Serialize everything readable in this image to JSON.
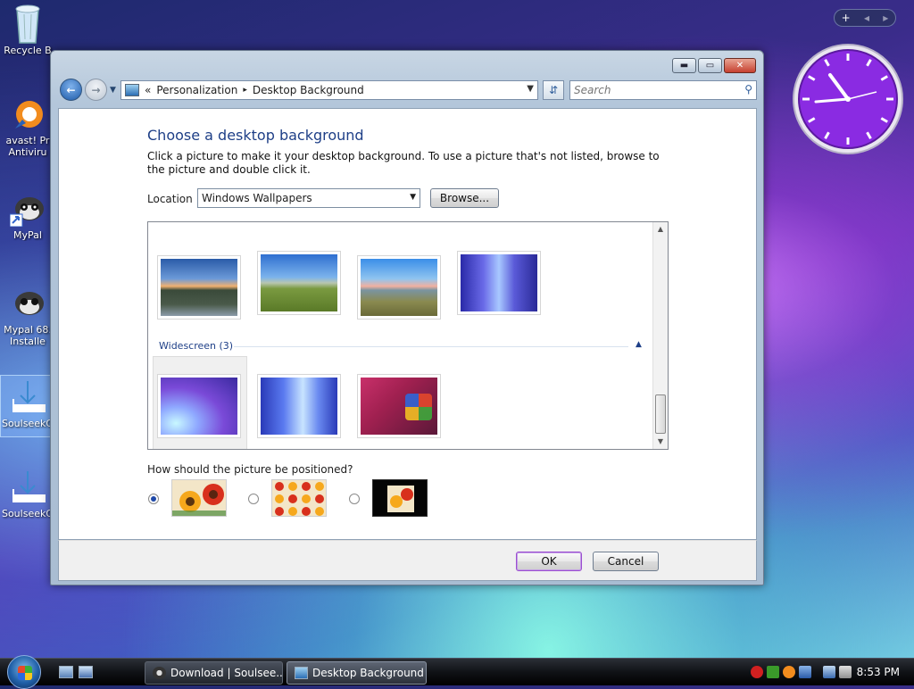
{
  "desktop": {
    "icons": [
      {
        "label": "Recycle B"
      },
      {
        "label": "avast! Pr",
        "label2": "Antiviru"
      },
      {
        "label": "MyPal"
      },
      {
        "label": "Mypal 68.",
        "label2": "Installe"
      },
      {
        "label": "SoulseekQ"
      },
      {
        "label": "SoulseekQ"
      }
    ]
  },
  "window": {
    "address": {
      "root_marker": "«",
      "crumbs": [
        "Personalization",
        "Desktop Background"
      ],
      "separator": "▸"
    },
    "search": {
      "placeholder": "Search"
    },
    "controls": {
      "minimize": "▬",
      "maximize": "▭",
      "close": "✕"
    },
    "heading": "Choose a desktop background",
    "description": "Click a picture to make it your desktop background. To use a picture that's not listed, browse to the picture and double click it.",
    "location": {
      "label": "Location",
      "value": "Windows Wallpapers",
      "browse_label": "Browse..."
    },
    "gallery": {
      "group": {
        "label": "Widescreen (3)"
      }
    },
    "position": {
      "question": "How should the picture be positioned?",
      "options": [
        "Fit to screen",
        "Tile",
        "Center"
      ],
      "selected": 0
    },
    "buttons": {
      "ok": "OK",
      "cancel": "Cancel"
    }
  },
  "gadgets": {
    "add": "+",
    "prev": "◂",
    "next": "▸"
  },
  "taskbar": {
    "tasks": [
      {
        "label": "Download | Soulsee..."
      },
      {
        "label": "Desktop Background",
        "active": true
      }
    ],
    "time": "8:53 PM"
  },
  "colors": {
    "accent": "#1e3f87",
    "ok_border": "#9b4fd0",
    "clock_face": "#8a2be2"
  }
}
